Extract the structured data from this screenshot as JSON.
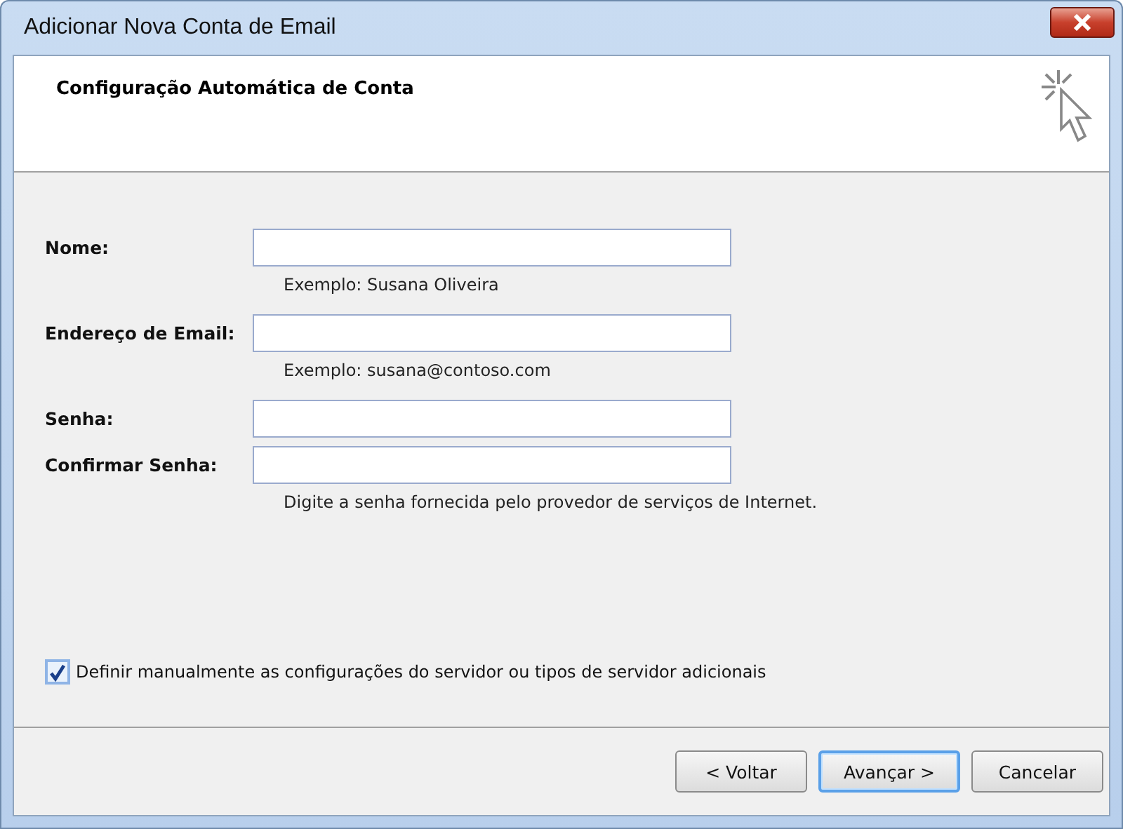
{
  "window": {
    "title": "Adicionar Nova Conta de Email"
  },
  "header": {
    "title": "Configuração Automática de Conta"
  },
  "fields": [
    {
      "label": "Nome:",
      "hint": "Exemplo: Susana Oliveira"
    },
    {
      "label": "Endereço de Email:",
      "hint": "Exemplo: susana@contoso.com"
    },
    {
      "label": "Senha:"
    },
    {
      "label": "Confirmar Senha:",
      "hint": "Digite a senha fornecida pelo provedor de serviços de Internet."
    }
  ],
  "checkbox": {
    "label": "Definir manualmente as configurações do servidor ou tipos de servidor adicionais",
    "checked": true
  },
  "buttons": [
    {
      "label": "< Voltar",
      "default": false
    },
    {
      "label": "Avançar >",
      "default": true
    },
    {
      "label": "Cancelar",
      "default": false
    }
  ]
}
